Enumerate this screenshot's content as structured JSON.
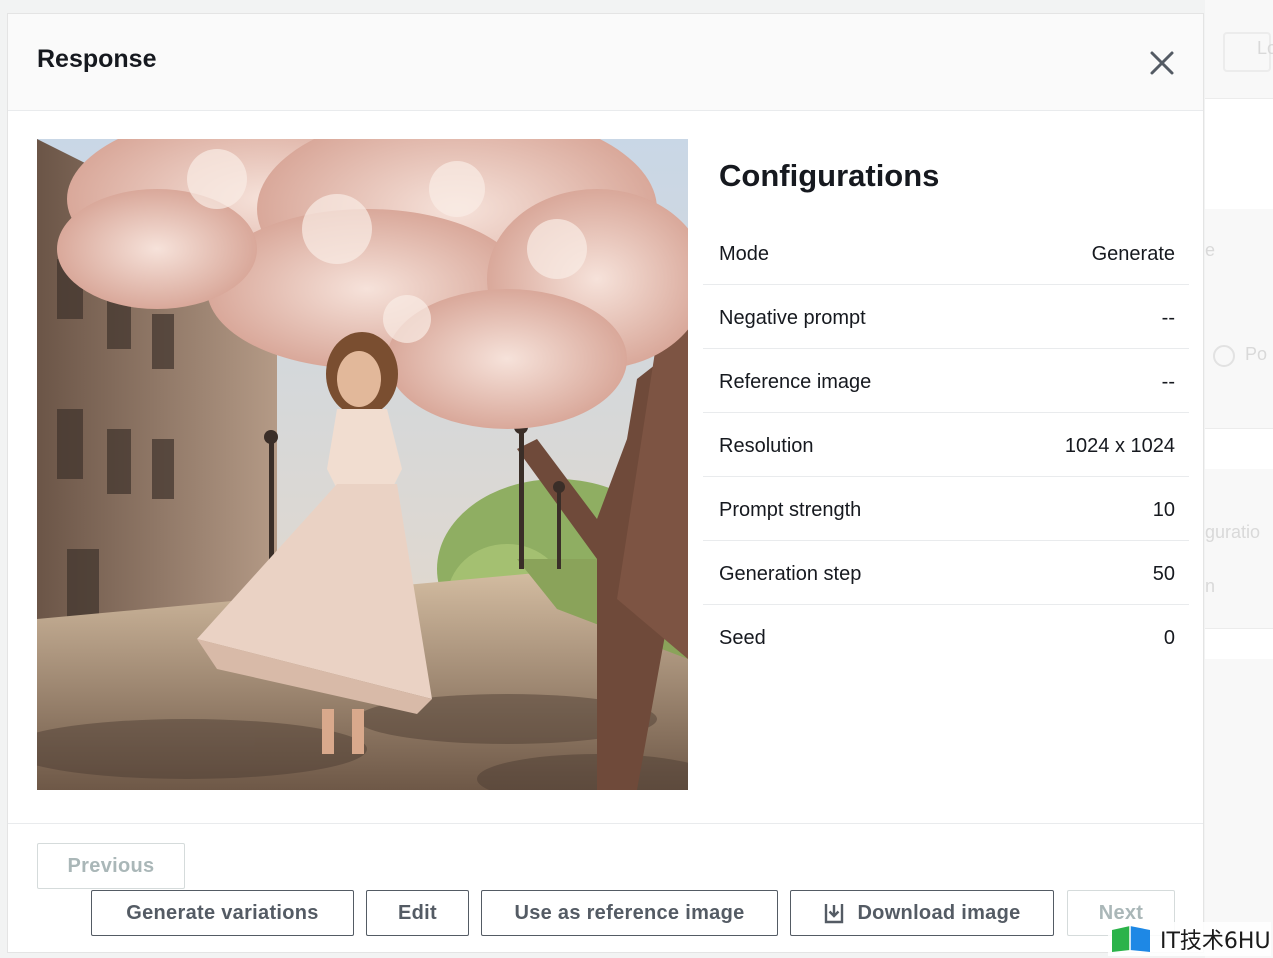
{
  "modal": {
    "title": "Response",
    "close_icon": "close-icon"
  },
  "image": {
    "alt": "Generated image: girl in a dress walking under a blossoming tree on a sunny street"
  },
  "configurations": {
    "title": "Configurations",
    "rows": [
      {
        "label": "Mode",
        "value": "Generate"
      },
      {
        "label": "Negative prompt",
        "value": "--"
      },
      {
        "label": "Reference image",
        "value": "--"
      },
      {
        "label": "Resolution",
        "value": "1024 x 1024"
      },
      {
        "label": "Prompt strength",
        "value": "10"
      },
      {
        "label": "Generation step",
        "value": "50"
      },
      {
        "label": "Seed",
        "value": "0"
      }
    ]
  },
  "footer": {
    "previous_label": "Previous",
    "generate_variations_label": "Generate variations",
    "edit_label": "Edit",
    "use_as_reference_label": "Use as reference image",
    "download_label": "Download image",
    "download_icon": "download-icon",
    "next_label": "Next"
  },
  "background": {
    "upload_fragment": "Lo",
    "radio_fragment": "Po",
    "config_fragment": "guratio",
    "e_fragment": "e",
    "n_fragment": "n"
  },
  "watermark": {
    "text": "IT技术6HU"
  },
  "colors": {
    "border": "#545b64",
    "disabled": "#aab7b8",
    "text": "#16191f",
    "divider": "#e9ebed"
  }
}
